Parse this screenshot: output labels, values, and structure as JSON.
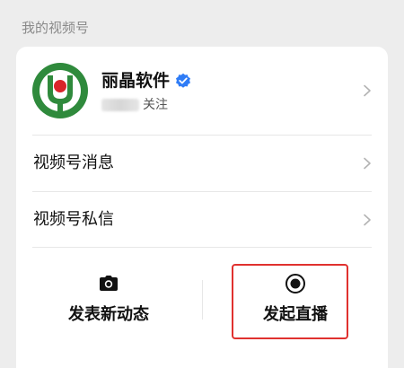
{
  "section": {
    "label": "我的视频号"
  },
  "profile": {
    "name": "丽晶软件",
    "follow_label": "关注",
    "avatar_icon": "lijing-logo-icon",
    "verified_icon": "verified-badge-icon",
    "brand_color": "#2f8a3c",
    "badge_color": "#2f7cf6"
  },
  "menu": [
    {
      "label": "视频号消息"
    },
    {
      "label": "视频号私信"
    }
  ],
  "actions": {
    "post": {
      "label": "发表新动态",
      "icon": "camera-icon"
    },
    "live": {
      "label": "发起直播",
      "icon": "record-icon"
    }
  },
  "highlight_color": "#e0312f"
}
